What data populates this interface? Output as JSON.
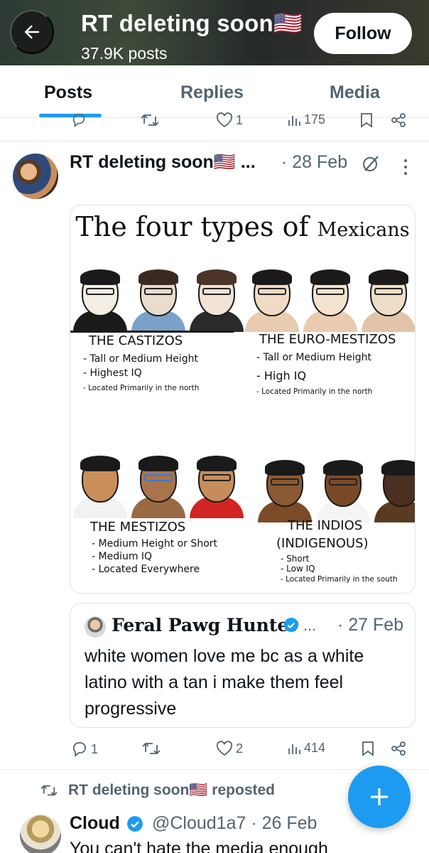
{
  "header": {
    "title": "RT deleting soon🇺🇸",
    "posts_count": "37.9K posts",
    "follow_label": "Follow"
  },
  "tabs": [
    {
      "label": "Posts",
      "active": true
    },
    {
      "label": "Replies",
      "active": false
    },
    {
      "label": "Media",
      "active": false
    }
  ],
  "top_actions": {
    "replies": "",
    "reposts": "",
    "likes": "1",
    "views": "175"
  },
  "post": {
    "author": "RT deleting soon🇺🇸 ...",
    "date": "· 28 Feb",
    "image": {
      "title_main": "The four types of ",
      "title_small": "Mexicans",
      "panels": [
        {
          "heading": "THE CASTIZOS",
          "lines": [
            "- Tall or Medium Height",
            "- Highest IQ",
            "- Located Primarily in the north"
          ]
        },
        {
          "heading": "THE EURO-MESTIZOS",
          "lines": [
            "- Tall or Medium Height",
            "- High IQ",
            "- Located Primarily in the north"
          ]
        },
        {
          "heading": "THE MESTIZOS",
          "lines": [
            "- Medium Height or Short",
            "- Medium IQ",
            "- Located Everywhere"
          ]
        },
        {
          "heading": "THE INDIOS",
          "heading2": "(INDIGENOUS)",
          "lines": [
            "- Short",
            "- Low IQ",
            "- Located Primarily in the south"
          ]
        }
      ]
    },
    "quote": {
      "author": "Feral Pawg Hunter",
      "dots": "...",
      "date": "· 27 Feb",
      "text": "white women love me bc as a white latino with a tan i make them feel progressive"
    },
    "actions": {
      "replies": "1",
      "reposts": "",
      "likes": "2",
      "views": "414"
    }
  },
  "repost_notice": "RT deleting soon🇺🇸 reposted",
  "next_post": {
    "author": "Cloud",
    "handle": "@Cloud1a7 · 26 Feb",
    "text": "You can't hate the media enough"
  },
  "colors": {
    "accent": "#1d9bf0",
    "muted": "#536471",
    "text": "#0f1419"
  }
}
